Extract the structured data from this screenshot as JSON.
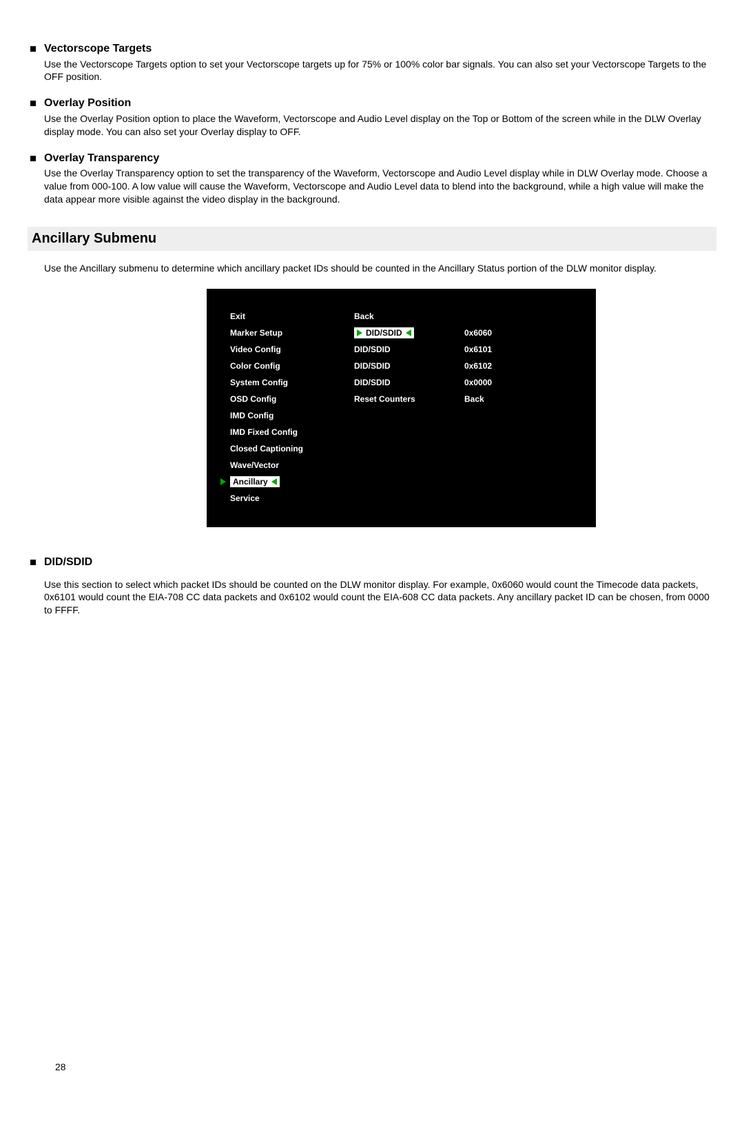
{
  "vectorscope": {
    "heading": "Vectorscope Targets",
    "body": "Use the Vectorscope Targets option to set your Vectorscope targets up for 75% or 100% color bar signals.  You can also set your Vectorscope Targets to the OFF position."
  },
  "overlay_position": {
    "heading": "Overlay Position",
    "body": "Use the Overlay Position option to place the Waveform, Vectorscope and Audio Level display on the Top or Bottom of the screen while in the DLW Overlay display mode.  You can also set your Overlay display to OFF."
  },
  "overlay_transparency": {
    "heading": "Overlay Transparency",
    "body": "Use the Overlay Transparency option to set the transparency of the Waveform, Vectorscope and Audio Level display while in DLW Overlay mode.  Choose a value from 000-100.  A low value will cause the Waveform, Vectorscope and Audio Level data to blend into the background, while a high value will make the data appear more visible against the video display in the background."
  },
  "submenu_title": "Ancillary Submenu",
  "submenu_text": "Use the Ancillary submenu to determine which ancillary packet IDs should be counted in the Ancillary Status portion of the DLW monitor display.",
  "menu": {
    "left": [
      "Exit",
      "Marker Setup",
      "Video Config",
      "Color Config",
      "System Config",
      "OSD Config",
      "IMD Config",
      "IMD Fixed Config",
      "Closed Captioning",
      "Wave/Vector",
      "Ancillary",
      "Service"
    ],
    "mid": [
      "Back",
      "DID/SDID",
      "DID/SDID",
      "DID/SDID",
      "DID/SDID",
      "Reset Counters"
    ],
    "right": [
      "",
      "0x6060",
      "0x6101",
      "0x6102",
      "0x0000",
      "Back"
    ]
  },
  "didsdid": {
    "heading": "DID/SDID",
    "body": "Use this section to select which packet IDs should be counted on the DLW monitor display.  For example, 0x6060 would count the Timecode data packets, 0x6101 would count the EIA-708 CC data packets and 0x6102 would count the EIA-608 CC data packets.  Any ancillary packet ID can be chosen, from 0000 to FFFF."
  },
  "page_number": "28"
}
